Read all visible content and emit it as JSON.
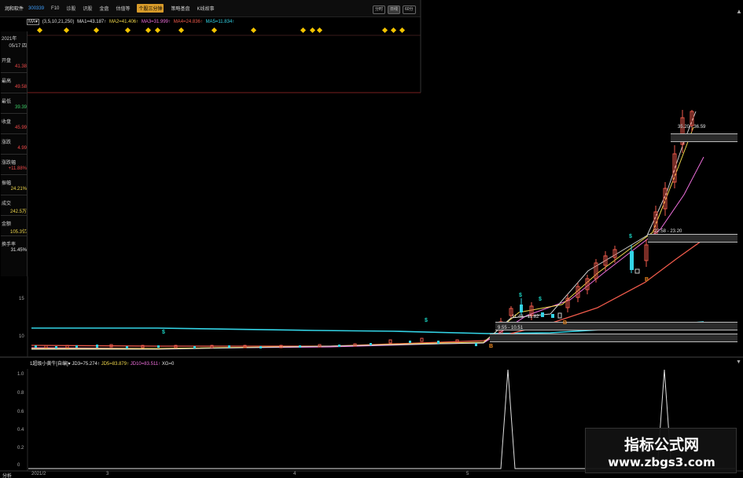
{
  "app": {
    "stock_name": "润和软件",
    "stock_code": "300339",
    "tabs": [
      "F10",
      "诊股",
      "识股",
      "金盘",
      "估值等",
      "个股三分钟",
      "策略基盘",
      "K线故事"
    ],
    "active_tab_index": 5,
    "right_buttons": [
      "分时",
      "日线",
      "60分"
    ],
    "right_active_index": 1,
    "accent": "#d89b2a"
  },
  "ma_bar": {
    "select_label": "MA▾",
    "params": "(3,5,10,21,250)",
    "items": [
      {
        "label": "MA1=43.187↑",
        "color": "#e6e6e6"
      },
      {
        "label": "MA2=41.406↑",
        "color": "#f2d94c"
      },
      {
        "label": "MA3=31.999↑",
        "color": "#ee6fdc"
      },
      {
        "label": "MA4=24.836↑",
        "color": "#ef5a4b"
      },
      {
        "label": "MA5=11.834↑",
        "color": "#33d4e6"
      }
    ]
  },
  "sidebar": {
    "date_year": "2021年",
    "date_day": "05/17 四",
    "rows": [
      {
        "label": "开盘",
        "value": "41.38",
        "color": "#f04a4a"
      },
      {
        "label": "最高",
        "value": "49.58",
        "color": "#f04a4a"
      },
      {
        "label": "最低",
        "value": "39.39",
        "color": "#3fd16a"
      },
      {
        "label": "收盘",
        "value": "45.99",
        "color": "#f04a4a"
      },
      {
        "label": "涨跌",
        "value": "4.99",
        "color": "#f04a4a"
      },
      {
        "label": "涨跌幅",
        "value": "+11.88%",
        "color": "#f04a4a"
      },
      {
        "label": "振幅",
        "value": "24.21%",
        "color": "#f2d94c"
      },
      {
        "label": "成交",
        "value": "242.5万",
        "color": "#f2d94c"
      },
      {
        "label": "金额",
        "value": "105.3亿",
        "color": "#f2d94c"
      },
      {
        "label": "换手率",
        "value": "31.45%",
        "color": "#e6e6e6"
      }
    ]
  },
  "price_axis": [
    "15",
    "10"
  ],
  "date_axis": [
    "2021/2",
    "3",
    "4",
    "5"
  ],
  "price_labels": [
    "35.20 - 36.59",
    "22.58 - 23.20",
    "11.48 - 11.82",
    "9.55 - 10.51"
  ],
  "indicator_bar": {
    "name": "1超级小黄牛[自编]▾",
    "items": [
      {
        "label": "JD3=75.274↑",
        "color": "#e6e6e6"
      },
      {
        "label": "JD5=83.879↑",
        "color": "#f2d94c"
      },
      {
        "label": "JD10=83.511↑",
        "color": "#ee6fdc"
      },
      {
        "label": "XG=0",
        "color": "#e6e6e6"
      }
    ]
  },
  "indicator_axis": [
    "1.0",
    "0.8",
    "0.6",
    "0.4",
    "0.2",
    "0"
  ],
  "bottom_left": "分析",
  "watermark": {
    "line1": "指标公式网",
    "line2": "www.zbgs3.com"
  },
  "marker_dollar": "$",
  "marker_b": "B"
}
